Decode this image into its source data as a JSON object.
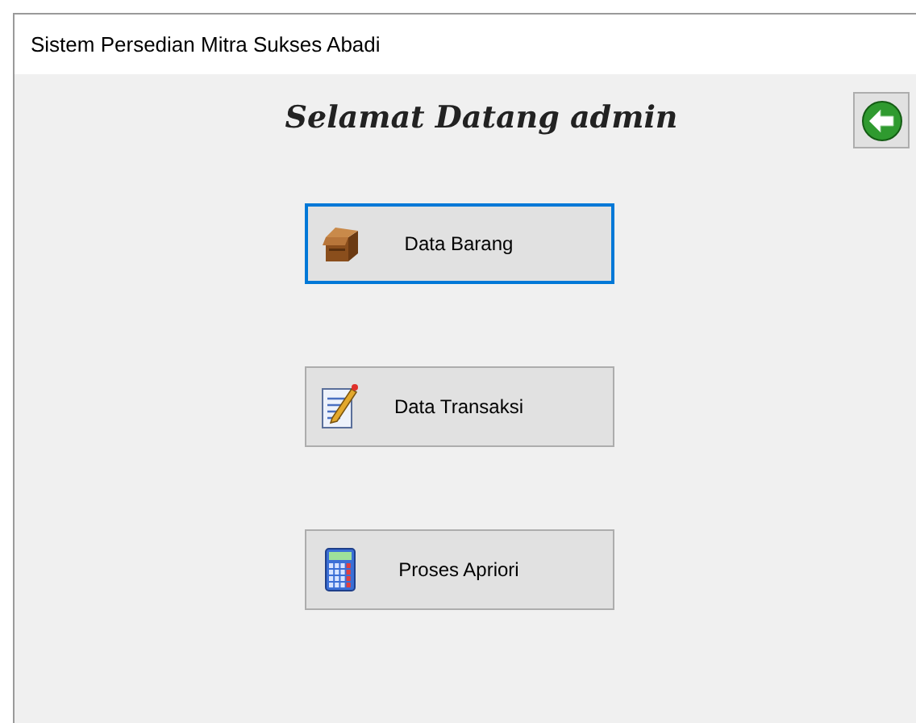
{
  "window": {
    "title": "Sistem Persedian Mitra Sukses Abadi"
  },
  "heading": "Selamat Datang admin",
  "menu_buttons": [
    {
      "label": "Data Barang",
      "kind": "box",
      "focused": true
    },
    {
      "label": "Data Transaksi",
      "kind": "notepad",
      "focused": false
    },
    {
      "label": "Proses Apriori",
      "kind": "calculator",
      "focused": false
    }
  ]
}
